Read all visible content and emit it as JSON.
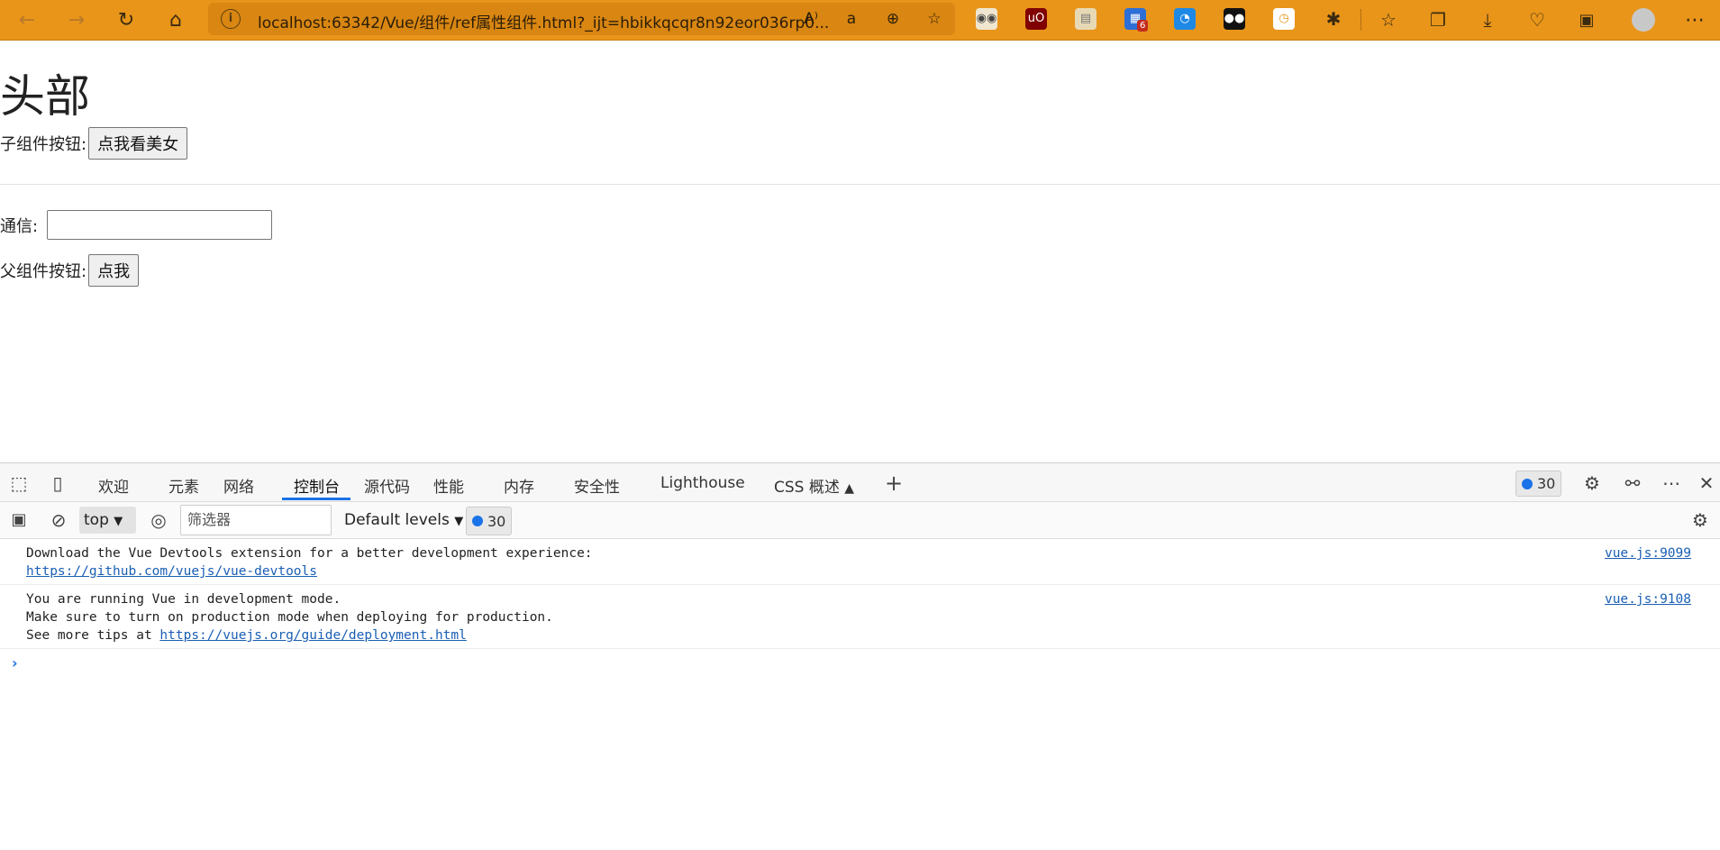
{
  "browser": {
    "url_host": "localhost",
    "url_rest": ":63342/Vue/组件/ref属性组件.html?_ijt=hbikkqcqr8n92eor036rp0...",
    "extension_badge": "6"
  },
  "page": {
    "heading": "头部",
    "child_button_label": "子组件按钮:",
    "child_button": "点我看美女",
    "comm_label": "通信:",
    "comm_value": "",
    "parent_button_label": "父组件按钮:",
    "parent_button": "点我"
  },
  "devtools": {
    "tabs": [
      "欢迎",
      "元素",
      "网络",
      "控制台",
      "源代码",
      "性能",
      "内存",
      "安全性",
      "Lighthouse",
      "CSS 概述"
    ],
    "active_tab": "控制台",
    "message_count": "30",
    "context": "top",
    "filter_placeholder": "筛选器",
    "levels": "Default levels",
    "issue_count": "30",
    "logs": [
      {
        "line1": "Download the Vue Devtools extension for a better development experience:",
        "link": "https://github.com/vuejs/vue-devtools",
        "source": "vue.js:9099"
      },
      {
        "line1": "You are running Vue in development mode.",
        "line2": "Make sure to turn on production mode when deploying for production.",
        "line3_prefix": "See more tips at ",
        "link": "https://vuejs.org/guide/deployment.html",
        "source": "vue.js:9108"
      }
    ]
  }
}
